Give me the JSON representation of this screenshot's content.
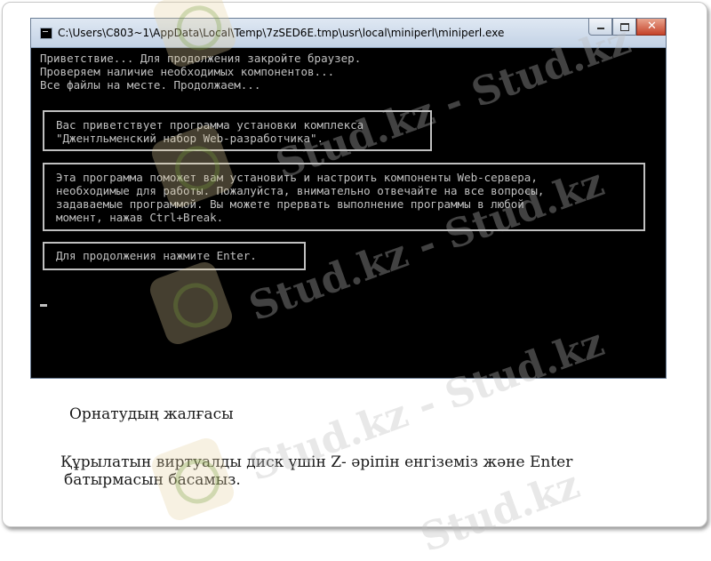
{
  "window": {
    "title": "C:\\Users\\C803~1\\AppData\\Local\\Temp\\7zSED6E.tmp\\usr\\local\\miniperl\\miniperl.exe",
    "minimize_label": "",
    "maximize_label": "",
    "close_label": "✕"
  },
  "console": {
    "lines": [
      "Приветствие... Для продолжения закройте браузер.",
      "Проверяем наличие необходимых компонентов...",
      "Все файлы на месте. Продолжаем..."
    ],
    "box1": [
      "Вас приветствует программа установки комплекса",
      "\"Джентльменский набор Web-разработчика\"."
    ],
    "box2": [
      "Эта программа поможет вам установить и настроить компоненты Web-сервера,",
      "необходимые для работы. Пожалуйста, внимательно отвечайте на все вопросы,",
      "задаваемые программой. Вы можете прервать выполнение программы в любой",
      "момент, нажав Ctrl+Break."
    ],
    "box3": [
      "Для продолжения нажмите Enter."
    ]
  },
  "slide": {
    "caption": "Орнатудың жалғасы",
    "instruction": [
      "Құрылатын виртуалды диск үшін Z- әріпін енгіземіз және Enter",
      "батырмасын басамыз."
    ]
  },
  "watermark": {
    "text": "Stud.kz - Stud.kz",
    "text2": "Stud.kz"
  }
}
